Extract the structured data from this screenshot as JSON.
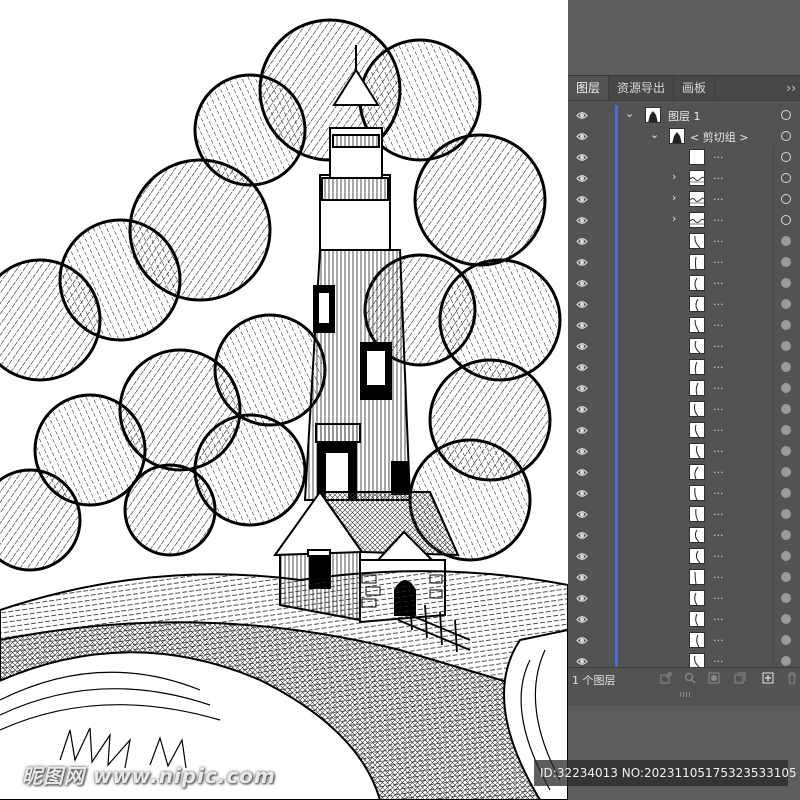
{
  "panel": {
    "tabs": [
      {
        "label": "图层",
        "active": true
      },
      {
        "label": "资源导出",
        "active": false
      },
      {
        "label": "画板",
        "active": false
      }
    ],
    "more_symbol": "››",
    "top_layer_label": "图层 1",
    "clip_group_label": "< 剪切组 >",
    "item_label": "...",
    "visibility_icon": "eye-icon",
    "expand_icon": "chevron-right-icon",
    "collapse_icon": "chevron-down-icon",
    "highlight_color": "#4a6fd9",
    "footer": {
      "layer_count": "1 个图层",
      "icons": [
        "export-icon",
        "search-icon",
        "clip-mask-icon",
        "new-sublayer-icon",
        "new-layer-icon",
        "trash-icon"
      ]
    }
  },
  "watermark": "昵图网 www.nipic.com",
  "image_id": "ID:32234013 NO:20231105175323533105"
}
